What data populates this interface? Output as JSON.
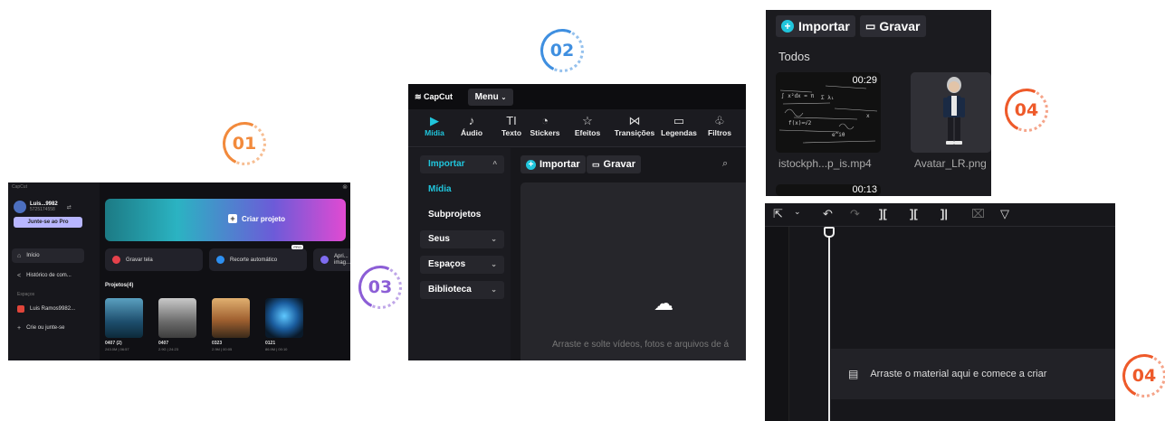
{
  "badges": {
    "b01": "01",
    "b02": "02",
    "b03": "03",
    "b04a": "04",
    "b04b": "04"
  },
  "colors": {
    "accent": "#20c5dc",
    "badge_orange": "#f28a3c",
    "badge_blue": "#3f8fe0",
    "badge_purple": "#8c5ed6",
    "badge_red": "#ee5a2a"
  },
  "home": {
    "brand": "CapCut",
    "user_name": "Luis...9982",
    "user_sub": "5725174558",
    "pro_button": "Junte-se ao Pro",
    "nav": [
      {
        "icon": "home-icon",
        "label": "Início"
      },
      {
        "icon": "share-icon",
        "label": "Histórico de com..."
      }
    ],
    "spaces_label": "Espaços",
    "space_item": "Luis Ramos9982...",
    "space_join": "Crie ou junte-se",
    "create_project": "Criar projeto",
    "tiles": [
      "Gravar tela",
      "Recorte automático",
      "Apri... imag..."
    ],
    "tile_badge": "PRO",
    "projects_header": "Projetos(4)",
    "projects": [
      {
        "name": "0407 (2)",
        "meta": "243.0M | 06:57"
      },
      {
        "name": "0407",
        "meta": "2.9G | 24:23"
      },
      {
        "name": "0323",
        "meta": "2.9M | 00:05"
      },
      {
        "name": "0121",
        "meta": "86.9M | 00:10"
      }
    ]
  },
  "editor": {
    "logo": "CapCut",
    "menu": "Menu",
    "tools": [
      {
        "icon": "media-icon",
        "glyph": "▶",
        "label": "Mídia"
      },
      {
        "icon": "audio-icon",
        "glyph": "♪",
        "label": "Áudio"
      },
      {
        "icon": "text-icon",
        "glyph": "TI",
        "label": "Texto"
      },
      {
        "icon": "stickers-icon",
        "glyph": "◔",
        "label": "Stickers"
      },
      {
        "icon": "effects-icon",
        "glyph": "☆",
        "label": "Efeitos"
      },
      {
        "icon": "transitions-icon",
        "glyph": "⋈",
        "label": "Transições"
      },
      {
        "icon": "captions-icon",
        "glyph": "▭",
        "label": "Legendas"
      },
      {
        "icon": "filters-icon",
        "glyph": "♧",
        "label": "Filtros"
      }
    ],
    "left": {
      "importar": "Importar",
      "midia": "Mídia",
      "subprojetos": "Subprojetos",
      "seus": "Seus",
      "espacos": "Espaços",
      "biblioteca": "Biblioteca"
    },
    "import_button": "Importar",
    "record_button": "Gravar",
    "drop_text": "Arraste e solte vídeos, fotos e arquivos de á"
  },
  "media_panel": {
    "import_button": "Importar",
    "record_button": "Gravar",
    "section": "Todos",
    "items": [
      {
        "name": "istockph...p_is.mp4",
        "duration": "00:29"
      },
      {
        "name": "Avatar_LR.png",
        "duration": ""
      }
    ],
    "partial_duration": "00:13"
  },
  "timeline": {
    "drop_text": "Arraste o material aqui e comece a criar"
  }
}
